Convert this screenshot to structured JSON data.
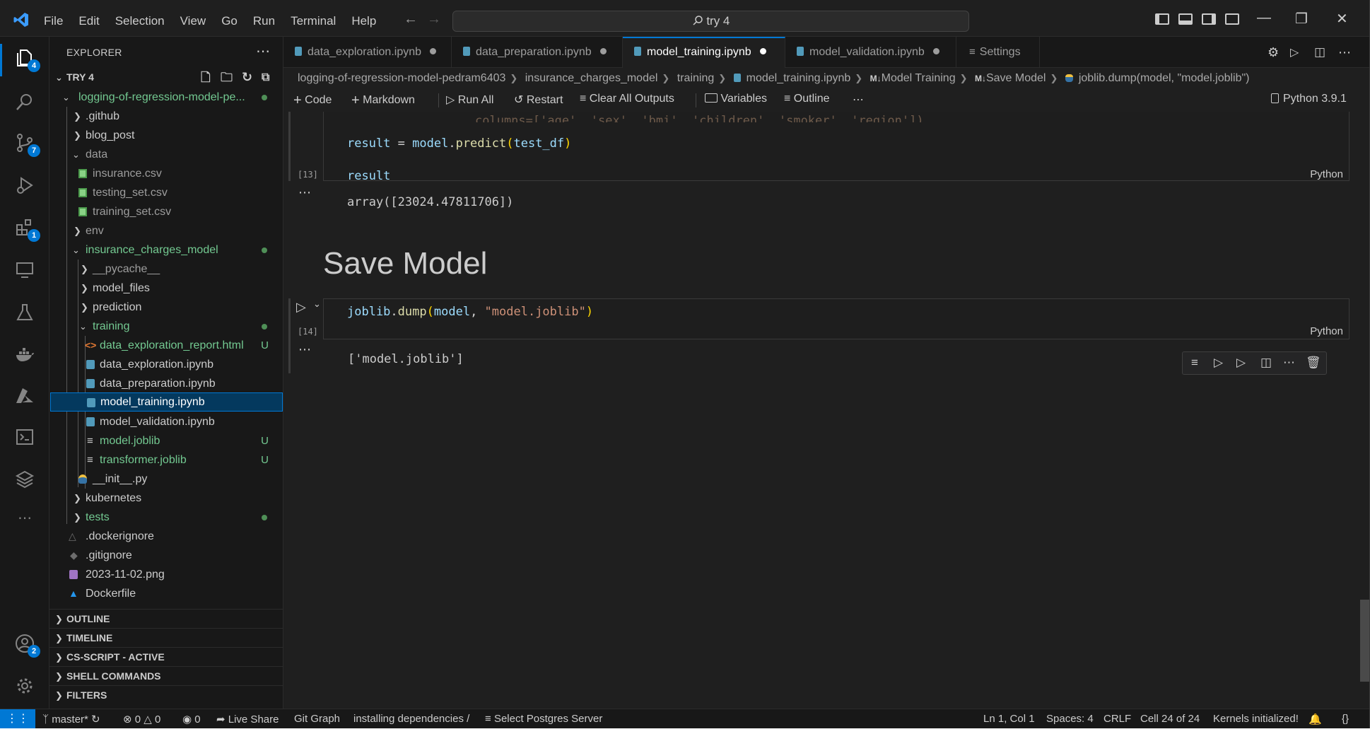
{
  "titlebar": {
    "menu": [
      "File",
      "Edit",
      "Selection",
      "View",
      "Go",
      "Run",
      "Terminal",
      "Help"
    ],
    "search_text": "try 4"
  },
  "activity": {
    "explorer_badge": "4",
    "scm_badge": "7",
    "extensions_badge": "1",
    "accounts_badge": "2"
  },
  "sidebar": {
    "title": "EXPLORER",
    "workspace": "TRY 4",
    "repo": "logging-of-regression-model-pe...",
    "items": {
      "github": ".github",
      "blog_post": "blog_post",
      "data": "data",
      "insurance_csv": "insurance.csv",
      "testing_csv": "testing_set.csv",
      "training_csv": "training_set.csv",
      "env": "env",
      "insurance_model": "insurance_charges_model",
      "pycache": "__pycache__",
      "model_files": "model_files",
      "prediction": "prediction",
      "training": "training",
      "report_html": "data_exploration_report.html",
      "data_exploration": "data_exploration.ipynb",
      "data_preparation": "data_preparation.ipynb",
      "model_training": "model_training.ipynb",
      "model_validation": "model_validation.ipynb",
      "model_joblib": "model.joblib",
      "transformer_joblib": "transformer.joblib",
      "init_py": "__init__.py",
      "kubernetes": "kubernetes",
      "tests": "tests",
      "dockerignore": ".dockerignore",
      "gitignore": ".gitignore",
      "png": "2023-11-02.png",
      "dockerfile": "Dockerfile"
    },
    "git_untracked": "U",
    "sections": [
      "OUTLINE",
      "TIMELINE",
      "CS-SCRIPT - ACTIVE",
      "SHELL COMMANDS",
      "FILTERS"
    ]
  },
  "tabs": [
    {
      "label": "data_exploration.ipynb"
    },
    {
      "label": "data_preparation.ipynb"
    },
    {
      "label": "model_training.ipynb"
    },
    {
      "label": "model_validation.ipynb"
    },
    {
      "label": "Settings"
    }
  ],
  "breadcrumb": [
    "logging-of-regression-model-pedram6403",
    "insurance_charges_model",
    "training",
    "model_training.ipynb",
    "Model Training",
    "Save Model",
    "joblib.dump(model, \"model.joblib\")"
  ],
  "breadcrumb_md_prefix": "M↓",
  "toolbar": {
    "code": "Code",
    "markdown": "Markdown",
    "run_all": "Run All",
    "restart": "Restart",
    "clear": "Clear All Outputs",
    "variables": "Variables",
    "outline": "Outline",
    "kernel": "Python 3.9.1"
  },
  "cells": {
    "c13_partial": "columns=['age', 'sex', 'bmi', 'children', 'smoker', 'region'])",
    "c13_line1": {
      "var": "result",
      "op": " = ",
      "obj": "model",
      "fn": "predict",
      "arg": "test_df"
    },
    "c13_line2": "result",
    "c13_count": "[13]",
    "c13_lang": "Python",
    "c13_output": "array([23024.47811706])",
    "heading": "Save Model",
    "c14_code": {
      "mod": "joblib",
      "fn": "dump",
      "arg": "model",
      "str": "\"model.joblib\""
    },
    "c14_count": "[14]",
    "c14_lang": "Python",
    "c14_output": "['model.joblib']"
  },
  "status": {
    "branch": "master*",
    "errors": "0",
    "warnings": "0",
    "ports": "0",
    "live_share": "Live Share",
    "git_graph": "Git Graph",
    "installing": "installing dependencies /",
    "postgres": "Select Postgres Server",
    "position": "Ln 1, Col 1",
    "spaces": "Spaces: 4",
    "eol": "CRLF",
    "cell": "Cell 24 of 24",
    "kernels": "Kernels initialized!"
  },
  "colors": {
    "accent": "#0078d4",
    "git_green": "#73c991",
    "html_icon": "#e37933"
  }
}
